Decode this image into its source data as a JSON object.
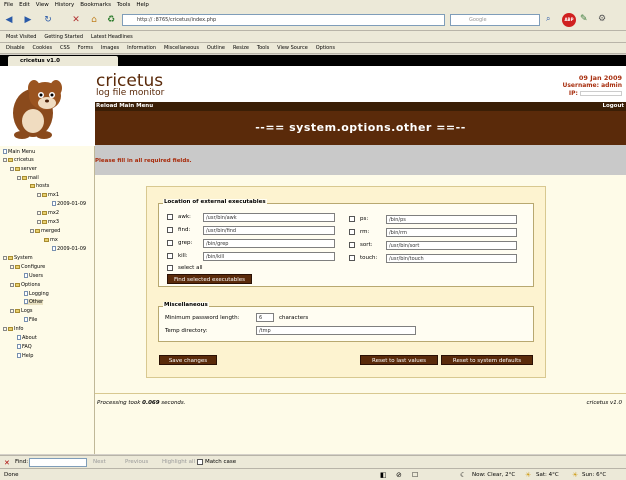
{
  "browser": {
    "menu": [
      "File",
      "Edit",
      "View",
      "History",
      "Bookmarks",
      "Tools",
      "Help"
    ],
    "url": "http://            :8765/cricetus/index.php",
    "search_placeholder": "Google",
    "bookmarks_row1": [
      "Disable",
      "Cookies",
      "CSS",
      "Forms",
      "Images",
      "Information",
      "Miscellaneous",
      "Outline",
      "Resize",
      "Tools",
      "View Source",
      "Options"
    ],
    "bookmarks_row2": [
      "Most Visited",
      "Getting Started",
      "Latest Headlines"
    ],
    "tab_title": "cricetus v1.0",
    "find_label": "Find:",
    "find_next": "Next",
    "find_previous": "Previous",
    "highlight_all": "Highlight all",
    "match_case": "Match case",
    "status": "Done",
    "weather": [
      "Now: Clear, 2°C",
      "Sat: 4°C",
      "Sun: 6°C"
    ]
  },
  "app": {
    "title": "cricetus",
    "subtitle": "log file monitor",
    "date": "09 Jan 2009",
    "username_label": "Username: admin",
    "ip_label": "IP:",
    "reload_link": "Reload Main Menu",
    "logout_link": "Logout",
    "banner": "--== system.options.other ==--",
    "notice": "Please fill in all required fields."
  },
  "sidebar": {
    "items": [
      "Main Menu",
      "cricetus",
      "server",
      "mail",
      "hosts",
      "mx1",
      "2009-01-09",
      "mx2",
      "mx3",
      "merged",
      "mx",
      "2009-01-09",
      "System",
      "Configure",
      "Users",
      "Options",
      "Logging",
      "Other",
      "Logs",
      "File",
      "Info",
      "About",
      "FAQ",
      "Help"
    ]
  },
  "form": {
    "exec_legend": "Location of external executables",
    "exec_left": [
      {
        "label": "awk:",
        "value": "/usr/bin/awk"
      },
      {
        "label": "find:",
        "value": "/usr/bin/find"
      },
      {
        "label": "grep:",
        "value": "/bin/grep"
      },
      {
        "label": "kill:",
        "value": "/bin/kill"
      }
    ],
    "exec_right": [
      {
        "label": "ps:",
        "value": "/bin/ps"
      },
      {
        "label": "rm:",
        "value": "/bin/rm"
      },
      {
        "label": "sort:",
        "value": "/usr/bin/sort"
      },
      {
        "label": "touch:",
        "value": "/usr/bin/touch"
      }
    ],
    "select_all": "select all",
    "find_selected_btn": "Find selected executables",
    "misc_legend": "Miscellaneous",
    "min_pw_label": "Minimum password length:",
    "min_pw_value": "6",
    "min_pw_unit": "characters",
    "temp_dir_label": "Temp directory:",
    "temp_dir_value": "/tmp",
    "save_btn": "Save changes",
    "reset_last_btn": "Reset to last values",
    "reset_default_btn": "Reset to system defaults"
  },
  "footer": {
    "processing_prefix": "Processing took ",
    "processing_value": "0.069",
    "processing_suffix": " seconds.",
    "version": "cricetus v1.0"
  }
}
